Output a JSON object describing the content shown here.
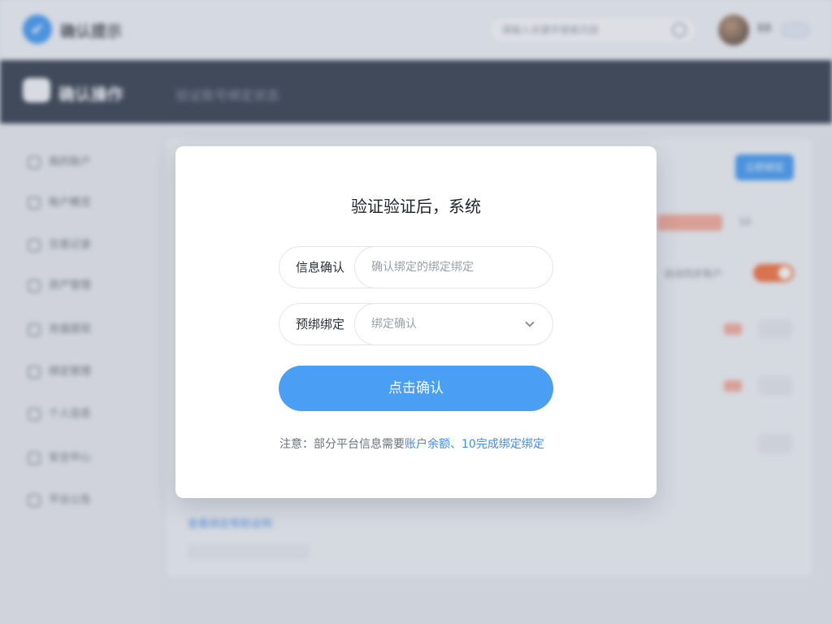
{
  "topbar": {
    "app_name": "确认提示",
    "search_placeholder": "请输入关键字搜索内容",
    "user_name": "BB"
  },
  "navbar": {
    "title": "确认操作",
    "subtitle": "验证账号绑定状态"
  },
  "sidebar": {
    "items": [
      {
        "label": "我的账户"
      },
      {
        "label": "账户概览"
      },
      {
        "label": "交易记录"
      },
      {
        "label": "资产管理"
      },
      {
        "label": "充值提现"
      },
      {
        "label": "绑定管理"
      },
      {
        "label": "个人信息"
      },
      {
        "label": "安全中心"
      },
      {
        "label": "平台公告"
      }
    ]
  },
  "content": {
    "top_button": "立即绑定",
    "switch_label": "自动同步账户",
    "link_text": "查看绑定帮助说明",
    "status_text": "10"
  },
  "modal": {
    "title": "验证验证后，系统",
    "field1": {
      "label": "信息确认",
      "placeholder": "确认绑定的绑定绑定"
    },
    "field2": {
      "label": "预绑绑定",
      "placeholder": "绑定确认"
    },
    "confirm_label": "点击确认",
    "note_prefix": "注意：部分平台信息需要",
    "note_link": "账户余额、10完成绑定绑定"
  },
  "colors": {
    "primary_button": "#4a9ff5",
    "navbar_bg": "#1f2a3c",
    "link": "#3f8de6",
    "switch_on": "#f0632c"
  }
}
